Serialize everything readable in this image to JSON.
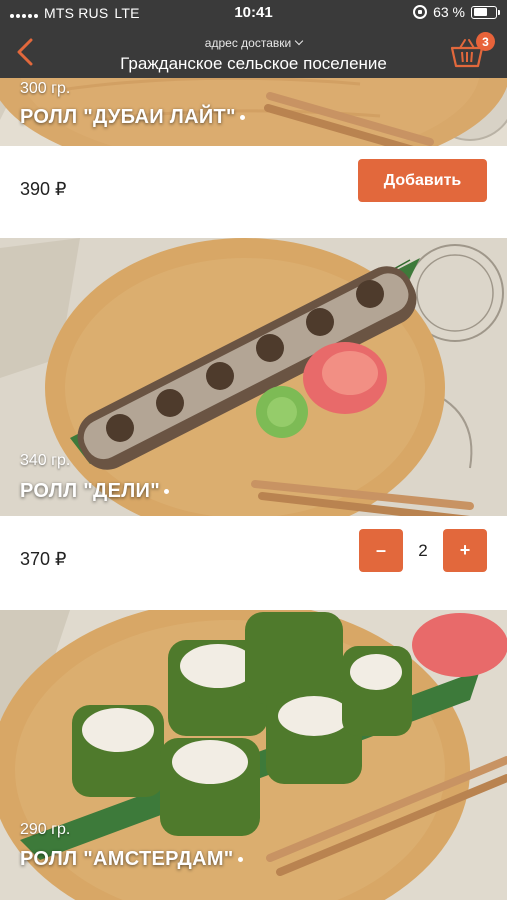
{
  "status_bar": {
    "carrier": "MTS RUS",
    "network": "LTE",
    "time": "10:41",
    "battery": "63 %",
    "battery_level": 0.63
  },
  "header": {
    "address_caption": "адрес доставки",
    "address_value": "Гражданское сельское поселение",
    "cart_count": "3",
    "icons": {
      "back": "back-arrow-icon",
      "cart": "basket-icon",
      "caret": "chevron-down-icon"
    }
  },
  "colors": {
    "accent": "#e2683c",
    "header_bg": "#3a3a3a",
    "badge": "#e8633a"
  },
  "products": [
    {
      "weight": "300 гр.",
      "name": "РОЛЛ \"ДУБАИ ЛАЙТ\"",
      "price": "390 ₽",
      "add_label": "Добавить"
    },
    {
      "weight": "340 гр.",
      "name": "РОЛЛ \"ДЕЛИ\"",
      "price": "370 ₽",
      "quantity": "2",
      "minus_label": "–",
      "plus_label": "+"
    },
    {
      "weight": "290 гр.",
      "name": "РОЛЛ \"АМСТЕРДАМ\""
    }
  ]
}
